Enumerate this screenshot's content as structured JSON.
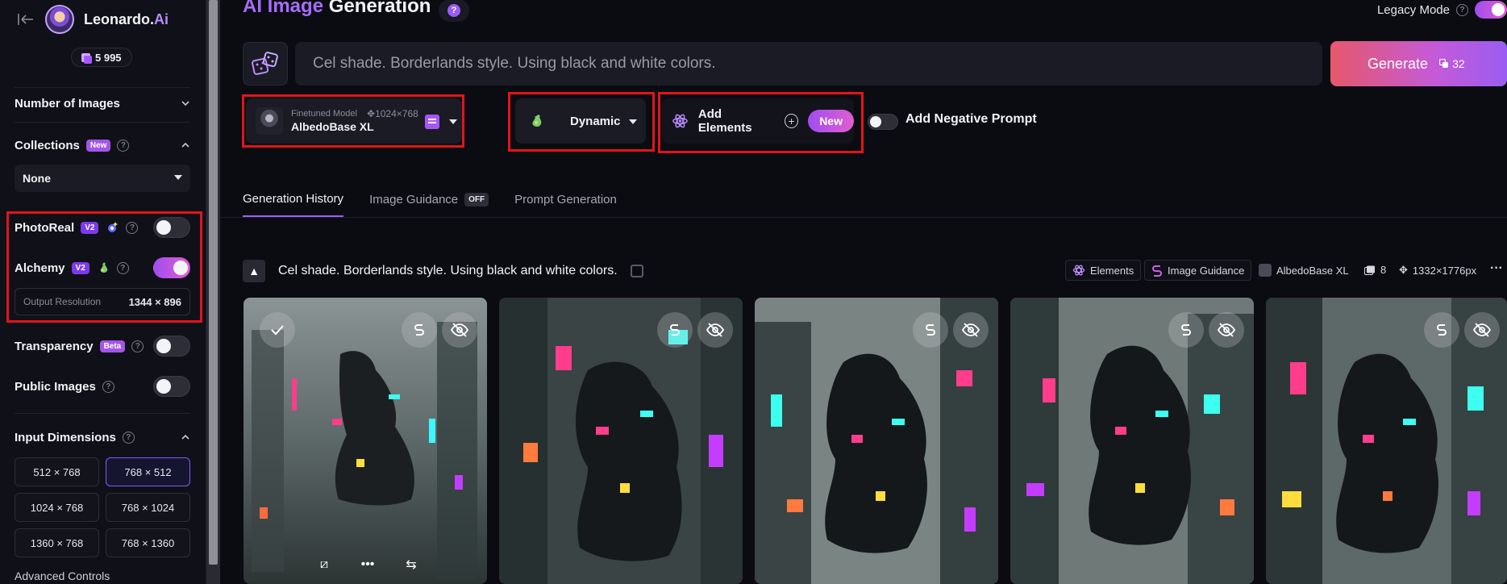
{
  "sidebar": {
    "brand_name": "Leonardo.",
    "brand_suffix": "Ai",
    "tokens": "5 995",
    "number_of_images_label": "Number of Images",
    "collections_label": "Collections",
    "collections_badge": "New",
    "collection_selected": "None",
    "photoreal_label": "PhotoReal",
    "photoreal_badge": "V2",
    "photoreal_on": false,
    "alchemy_label": "Alchemy",
    "alchemy_badge": "V2",
    "alchemy_on": true,
    "output_resolution_label": "Output Resolution",
    "output_resolution_value": "1344 × 896",
    "transparency_label": "Transparency",
    "transparency_badge": "Beta",
    "public_images_label": "Public Images",
    "input_dimensions_label": "Input Dimensions",
    "dimensions": [
      "512 × 768",
      "768 × 512",
      "1024 × 768",
      "768 × 1024",
      "1360 × 768",
      "768 × 1360"
    ],
    "selected_dimension": "768 × 512",
    "advanced_controls_label": "Advanced Controls"
  },
  "header": {
    "title_accent": "AI Image",
    "title_rest": " Generation",
    "help_glyph": "?",
    "legacy_mode_label": "Legacy Mode",
    "legacy_mode_on": true
  },
  "prompt": {
    "placeholder": "Cel shade. Borderlands style. Using black and white colors.",
    "generate_label": "Generate",
    "generate_cost": "32"
  },
  "toolbar": {
    "model_sub": "Finetuned Model",
    "model_name": "AlbedoBase XL",
    "model_dims": "1024×768",
    "style_label": "Dynamic",
    "add_elements_label": "Add Elements",
    "new_badge": "New",
    "negative_prompt_label": "Add Negative Prompt"
  },
  "tabs": [
    {
      "label": "Generation History",
      "active": true
    },
    {
      "label": "Image Guidance",
      "badge": "OFF"
    },
    {
      "label": "Prompt Generation"
    }
  ],
  "history": {
    "prompt": "Cel shade. Borderlands style. Using black and white colors.",
    "chip_elements": "Elements",
    "chip_guidance": "Image Guidance",
    "model": "AlbedoBase XL",
    "count": "8",
    "size": "1332×1776px",
    "more": "···"
  },
  "images": [
    {
      "name": "generated-image-1"
    },
    {
      "name": "generated-image-2"
    },
    {
      "name": "generated-image-3"
    },
    {
      "name": "generated-image-4"
    },
    {
      "name": "generated-image-5"
    }
  ],
  "colors": {
    "accent_purple": "#9b5cf6",
    "highlight_red": "#e3141b",
    "generate_gradient_start": "#e6586b",
    "generate_gradient_end": "#9a5cf0"
  }
}
